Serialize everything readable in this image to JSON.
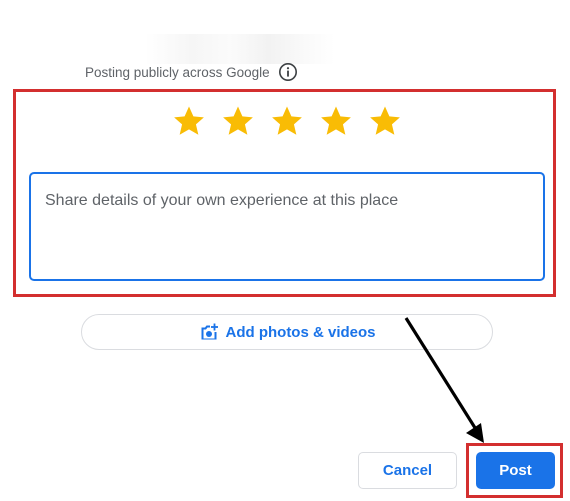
{
  "header": {
    "posting_notice": "Posting publicly across Google",
    "info_icon": "info-icon"
  },
  "rating": {
    "stars_selected": 5,
    "stars_total": 5,
    "star_color": "#f9bc05",
    "star_icon": "star-icon"
  },
  "review": {
    "placeholder": "Share details of your own experience at this place",
    "value": ""
  },
  "media": {
    "add_label": "Add photos & videos",
    "icon": "add-photo-icon"
  },
  "actions": {
    "cancel_label": "Cancel",
    "post_label": "Post"
  },
  "colors": {
    "accent": "#1a73e8",
    "annotation": "#d32f2f",
    "arrow": "#000000"
  }
}
